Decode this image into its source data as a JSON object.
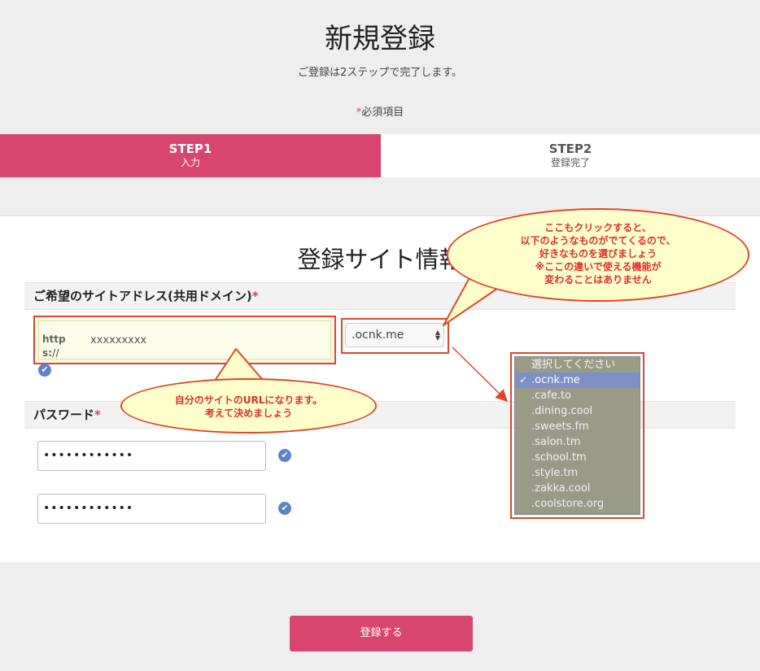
{
  "header": {
    "title": "新規登録",
    "subtitle": "ご登録は2ステップで完了します。",
    "required_star": "*",
    "required_label": "必須項目"
  },
  "steps": [
    {
      "name": "STEP1",
      "label": "入力",
      "active": true
    },
    {
      "name": "STEP2",
      "label": "登録完了",
      "active": false
    }
  ],
  "section": {
    "title": "登録サイト情報"
  },
  "site_address": {
    "label": "ご希望のサイトアドレス(共用ドメイン)",
    "required_star": "*",
    "url_prefix": "https://",
    "value": "xxxxxxxxx",
    "selected_domain": ".ocnk.me",
    "domain_options": [
      ".ocnk.me",
      ".cafe.to",
      ".dining.cool",
      ".sweets.fm",
      ".salon.tm",
      ".school.tm",
      ".style.tm",
      ".zakka.cool",
      ".coolstore.org"
    ],
    "dropdown_placeholder": "選択してください",
    "check_mark": "✔"
  },
  "password": {
    "label": "パスワード",
    "required_star": "*",
    "value_masked": "••••••••••••",
    "confirm_masked": "••••••••••••"
  },
  "annotations": {
    "domain_note": [
      "ここもクリックすると、",
      "以下のようなものがでてくるので、",
      "好きなものを選びましょう",
      "※ここの違いで使える機能が",
      "変わることはありません"
    ],
    "url_note": [
      "自分のサイトのURLになります。",
      "考えて決めましょう"
    ]
  },
  "submit": {
    "label": "登録する"
  },
  "colors": {
    "accent": "#d8466f",
    "annotation_red": "#e0462a",
    "annotation_fill": "#ffffcc",
    "check_blue": "#5a83c8"
  }
}
